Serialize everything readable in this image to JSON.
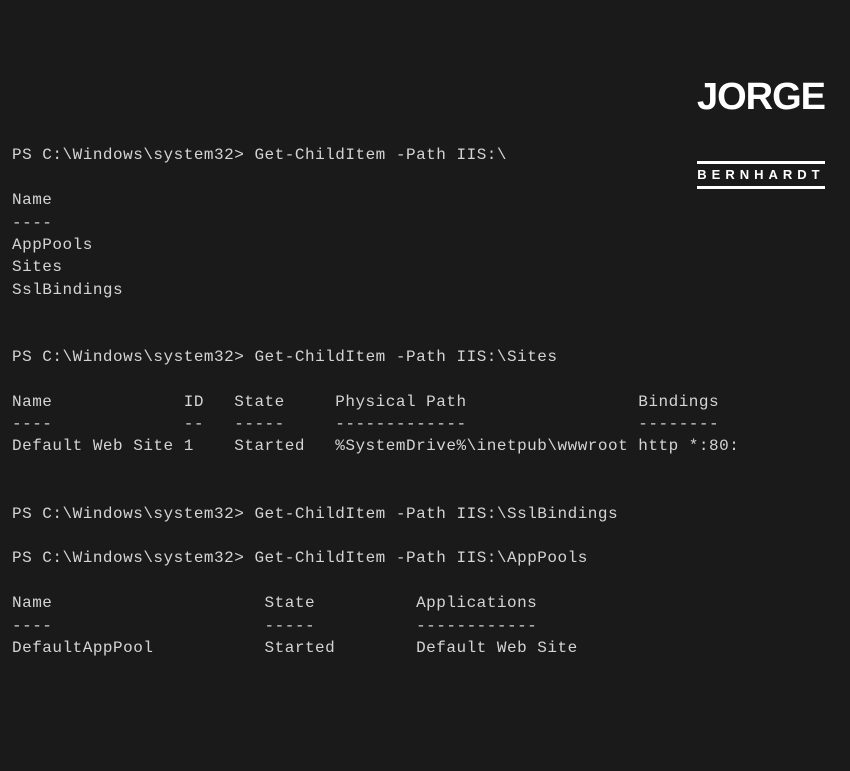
{
  "watermark": {
    "main": "JORGE",
    "sub": "BERNHARDT"
  },
  "terminal": {
    "prompt": "PS C:\\Windows\\system32>",
    "block1": {
      "cmd": "Get-ChildItem -Path IIS:\\",
      "header": "Name",
      "divider": "----",
      "rows": [
        "AppPools",
        "Sites",
        "SslBindings"
      ]
    },
    "block2": {
      "cmd": "Get-ChildItem -Path IIS:\\Sites",
      "headers": {
        "name": "Name",
        "id": "ID",
        "state": "State",
        "path": "Physical Path",
        "bindings": "Bindings"
      },
      "dividers": {
        "name": "----",
        "id": "--",
        "state": "-----",
        "path": "-------------",
        "bindings": "--------"
      },
      "row": {
        "name": "Default Web Site",
        "id": "1",
        "state": "Started",
        "path": "%SystemDrive%\\inetpub\\wwwroot",
        "bindings": "http *:80:"
      }
    },
    "block3": {
      "cmd": "Get-ChildItem -Path IIS:\\SslBindings"
    },
    "block4": {
      "cmd": "Get-ChildItem -Path IIS:\\AppPools",
      "headers": {
        "name": "Name",
        "state": "State",
        "apps": "Applications"
      },
      "dividers": {
        "name": "----",
        "state": "-----",
        "apps": "------------"
      },
      "row": {
        "name": "DefaultAppPool",
        "state": "Started",
        "apps": "Default Web Site"
      }
    }
  }
}
